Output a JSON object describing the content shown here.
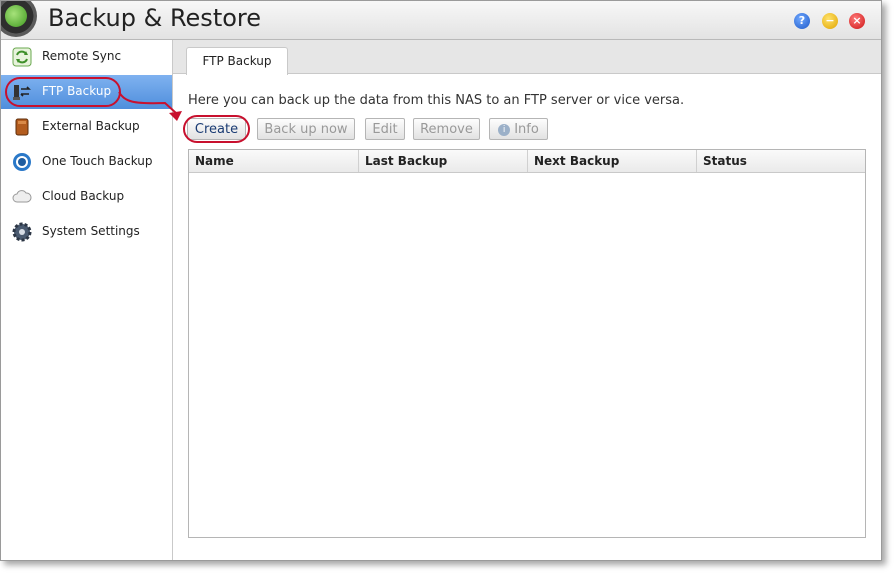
{
  "window": {
    "title": "Backup & Restore",
    "controls": {
      "help": "?",
      "minimize": "−",
      "close": "×"
    }
  },
  "sidebar": {
    "items": [
      {
        "label": "Remote Sync",
        "icon": "sync-arrows-icon",
        "active": false
      },
      {
        "label": "FTP Backup",
        "icon": "ftp-transfer-icon",
        "active": true
      },
      {
        "label": "External Backup",
        "icon": "external-drive-icon",
        "active": false
      },
      {
        "label": "One Touch Backup",
        "icon": "one-touch-button-icon",
        "active": false
      },
      {
        "label": "Cloud Backup",
        "icon": "cloud-icon",
        "active": false
      },
      {
        "label": "System Settings",
        "icon": "gear-icon",
        "active": false
      }
    ]
  },
  "main": {
    "tab": "FTP Backup",
    "description": "Here you can back up the data from this NAS to an FTP server or vice versa.",
    "toolbar": {
      "create": "Create",
      "backup_now": "Back up now",
      "edit": "Edit",
      "remove": "Remove",
      "info": "Info"
    },
    "table": {
      "columns": [
        "Name",
        "Last Backup",
        "Next Backup",
        "Status"
      ],
      "rows": []
    }
  },
  "colors": {
    "accent": "#4f8edc",
    "highlight": "#c8102e"
  }
}
